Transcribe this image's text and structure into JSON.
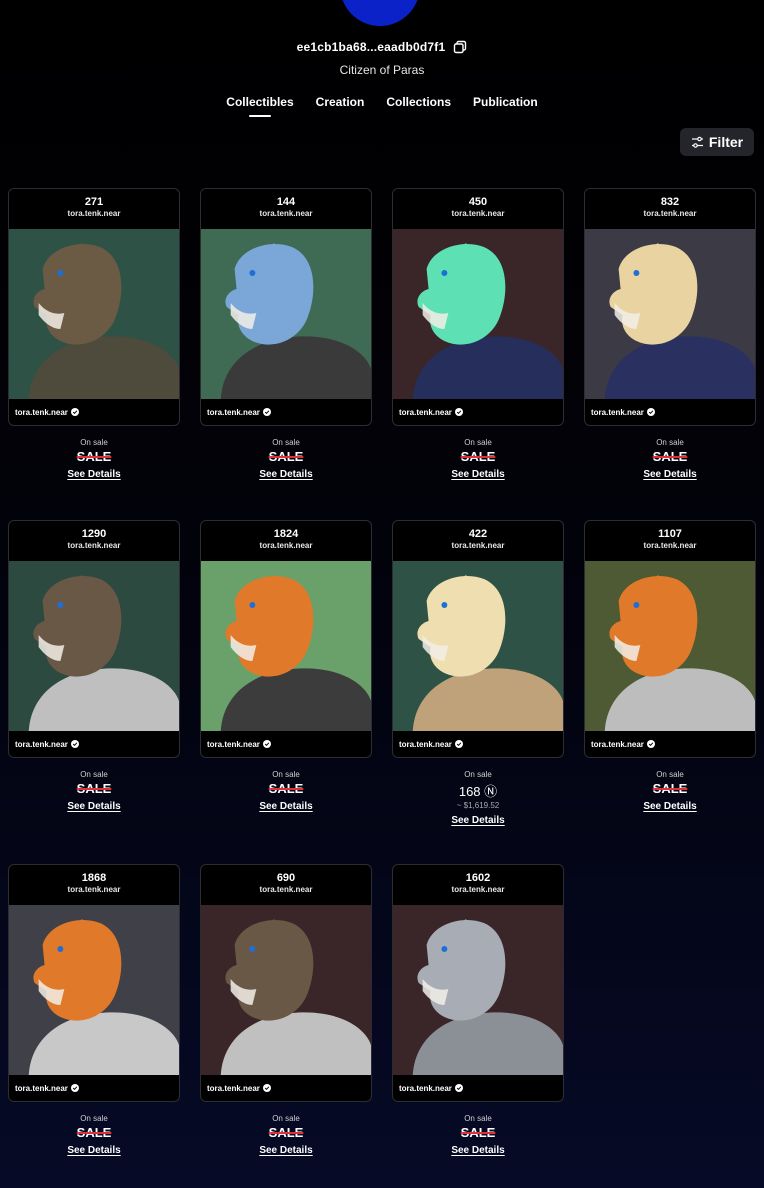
{
  "profile": {
    "account_id": "ee1cb1ba68...eaadb0d7f1",
    "subtitle": "Citizen of Paras"
  },
  "tabs": [
    {
      "label": "Collectibles",
      "active": true
    },
    {
      "label": "Creation",
      "active": false
    },
    {
      "label": "Collections",
      "active": false
    },
    {
      "label": "Publication",
      "active": false
    }
  ],
  "filter": {
    "label": "Filter"
  },
  "cards": [
    {
      "number": "271",
      "owner": "tora.tenk.near",
      "status": "On sale",
      "price": "SALE",
      "details": "See Details",
      "bg": "#2e5245",
      "fur": "#6b5a44",
      "gear": "#4e4a3c"
    },
    {
      "number": "144",
      "owner": "tora.tenk.near",
      "status": "On sale",
      "price": "SALE",
      "details": "See Details",
      "bg": "#3f6b55",
      "fur": "#7ba7d8",
      "gear": "#3a3a3a"
    },
    {
      "number": "450",
      "owner": "tora.tenk.near",
      "status": "On sale",
      "price": "SALE",
      "details": "See Details",
      "bg": "#3a2528",
      "fur": "#5ee0b5",
      "gear": "#262f5c"
    },
    {
      "number": "832",
      "owner": "tora.tenk.near",
      "status": "On sale",
      "price": "SALE",
      "details": "See Details",
      "bg": "#3b3a45",
      "fur": "#e9d3a0",
      "gear": "#2a3060"
    },
    {
      "number": "1290",
      "owner": "tora.tenk.near",
      "status": "On sale",
      "price": "SALE",
      "details": "See Details",
      "bg": "#2d4a40",
      "fur": "#6a5846",
      "gear": "#bfbfbf"
    },
    {
      "number": "1824",
      "owner": "tora.tenk.near",
      "status": "On sale",
      "price": "SALE",
      "details": "See Details",
      "bg": "#6aa06a",
      "fur": "#e07a2a",
      "gear": "#3c3c3c"
    },
    {
      "number": "422",
      "owner": "tora.tenk.near",
      "status": "On sale",
      "price": "168 Ⓝ",
      "usd": "~ $1,619.52",
      "details": "See Details",
      "bg": "#2e5245",
      "fur": "#efdfb0",
      "gear": "#bfa27a"
    },
    {
      "number": "1107",
      "owner": "tora.tenk.near",
      "status": "On sale",
      "price": "SALE",
      "details": "See Details",
      "bg": "#4d5a34",
      "fur": "#e07a2a",
      "gear": "#bdbdbd"
    },
    {
      "number": "1868",
      "owner": "tora.tenk.near",
      "status": "On sale",
      "price": "SALE",
      "details": "See Details",
      "bg": "#3f4048",
      "fur": "#e07a2a",
      "gear": "#c8c8c8"
    },
    {
      "number": "690",
      "owner": "tora.tenk.near",
      "status": "On sale",
      "price": "SALE",
      "details": "See Details",
      "bg": "#3a2528",
      "fur": "#6a5846",
      "gear": "#c0c0c0"
    },
    {
      "number": "1602",
      "owner": "tora.tenk.near",
      "status": "On sale",
      "price": "SALE",
      "details": "See Details",
      "bg": "#3a2528",
      "fur": "#a8acb4",
      "gear": "#8b8f96"
    }
  ]
}
